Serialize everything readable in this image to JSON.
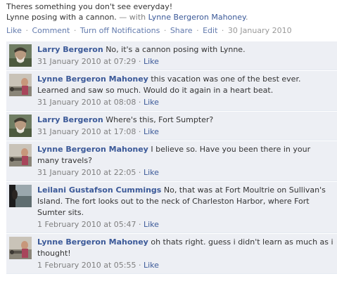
{
  "post": {
    "line1": "Theres something you don't see everyday!",
    "line2_text": "Lynne posing with a cannon.",
    "with_prefix": " — with ",
    "with_name": "Lynne Bergeron Mahoney",
    "with_suffix": ".",
    "actions": {
      "like": "Like",
      "comment": "Comment",
      "notifications": "Turn off Notifications",
      "share": "Share",
      "edit": "Edit",
      "date": "30 January 2010",
      "sep": "·"
    }
  },
  "comments": [
    {
      "author": "Larry Bergeron",
      "text": "No, it's a cannon posing with Lynne.",
      "time": "31 January 2010 at 07:29",
      "like": "Like",
      "avatar": "larry"
    },
    {
      "author": "Lynne Bergeron Mahoney",
      "text": "this vacation was one of the best ever. Learned and saw so much. Would do it again in a heart beat.",
      "time": "31 January 2010 at 08:08",
      "like": "Like",
      "avatar": "lynne"
    },
    {
      "author": "Larry Bergeron",
      "text": "Where's this, Fort Sumpter?",
      "time": "31 January 2010 at 17:08",
      "like": "Like",
      "avatar": "larry"
    },
    {
      "author": "Lynne Bergeron Mahoney",
      "text": "I believe so. Have you been there in your many travels?",
      "time": "31 January 2010 at 22:05",
      "like": "Like",
      "avatar": "lynne"
    },
    {
      "author": "Leilani Gustafson Cummings",
      "text": "No, that was at Fort Moultrie on Sullivan's Island. The fort looks out to the neck of Charleston Harbor, where Fort Sumter sits.",
      "time": "1 February 2010 at 05:47",
      "like": "Like",
      "avatar": "leilani"
    },
    {
      "author": "Lynne Bergeron Mahoney",
      "text": "oh thats right. guess i didn't learn as much as i thought!",
      "time": "1 February 2010 at 05:55",
      "like": "Like",
      "avatar": "lynne"
    }
  ]
}
